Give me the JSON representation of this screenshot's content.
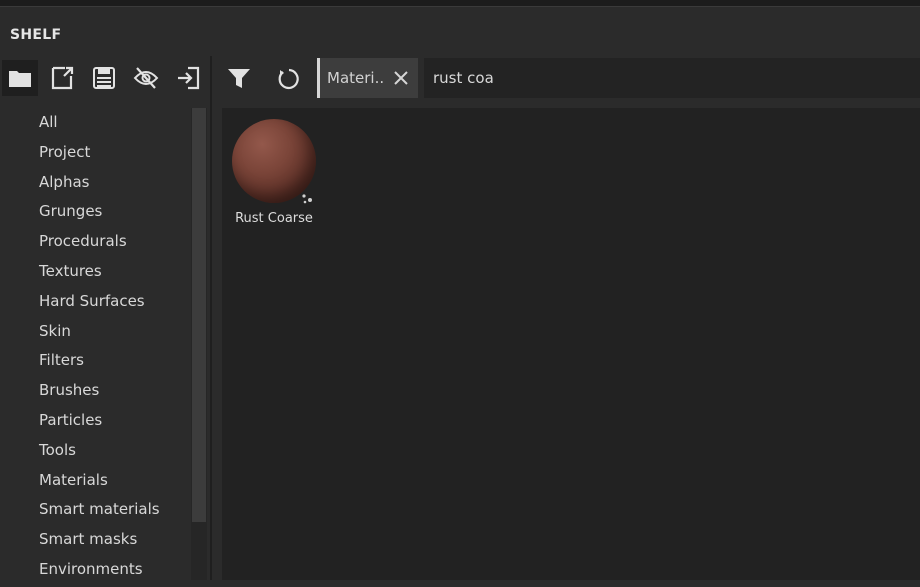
{
  "panel": {
    "title": "SHELF"
  },
  "left_toolbar": {
    "icons": [
      "folder-icon",
      "new-document-icon",
      "save-icon",
      "hide-icon",
      "import-icon"
    ]
  },
  "categories": [
    "All",
    "Project",
    "Alphas",
    "Grunges",
    "Procedurals",
    "Textures",
    "Hard Surfaces",
    "Skin",
    "Filters",
    "Brushes",
    "Particles",
    "Tools",
    "Materials",
    "Smart materials",
    "Smart masks",
    "Environments"
  ],
  "toolbar": {
    "filter_icon": "filter-icon",
    "refresh_icon": "refresh-icon",
    "filter_chip": {
      "label": "Materi..",
      "close_icon": "close-icon"
    },
    "search": {
      "value": "rust coa"
    }
  },
  "results": [
    {
      "label": "Rust Coarse",
      "thumbnail_color": "#7b4539"
    }
  ],
  "colors": {
    "background": "#2b2b2b",
    "content_background": "#222222",
    "text": "#d6d6d6"
  }
}
